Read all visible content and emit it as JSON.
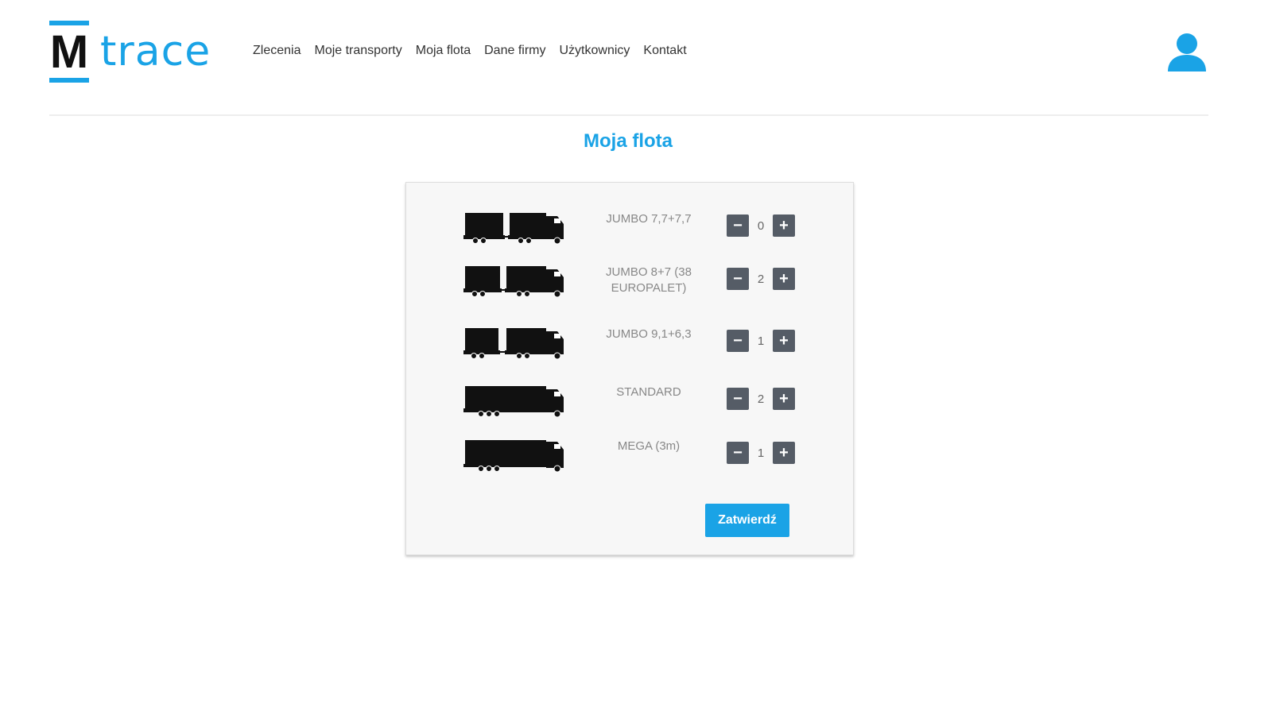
{
  "brand": {
    "letter": "M",
    "wordmark": "trace",
    "accent_color": "#1aa3e6"
  },
  "nav": {
    "items": [
      {
        "label": "Zlecenia"
      },
      {
        "label": "Moje transporty"
      },
      {
        "label": "Moja flota"
      },
      {
        "label": "Dane firmy"
      },
      {
        "label": "Użytkownicy"
      },
      {
        "label": "Kontakt"
      }
    ]
  },
  "header": {
    "user_icon": "user-icon"
  },
  "page": {
    "title": "Moja flota"
  },
  "fleet": {
    "items": [
      {
        "label": "JUMBO 7,7+7,7",
        "count": "0",
        "icon": "truck-trailer-icon"
      },
      {
        "label": "JUMBO 8+7 (38 EUROPALET)",
        "count": "2",
        "icon": "truck-trailer-icon"
      },
      {
        "label": "JUMBO 9,1+6,3",
        "count": "1",
        "icon": "truck-trailer-icon"
      },
      {
        "label": "STANDARD",
        "count": "2",
        "icon": "semi-truck-icon"
      },
      {
        "label": "MEGA (3m)",
        "count": "1",
        "icon": "semi-truck-icon"
      }
    ],
    "decrement_symbol": "−",
    "increment_symbol": "+",
    "confirm_label": "Zatwierdź"
  }
}
